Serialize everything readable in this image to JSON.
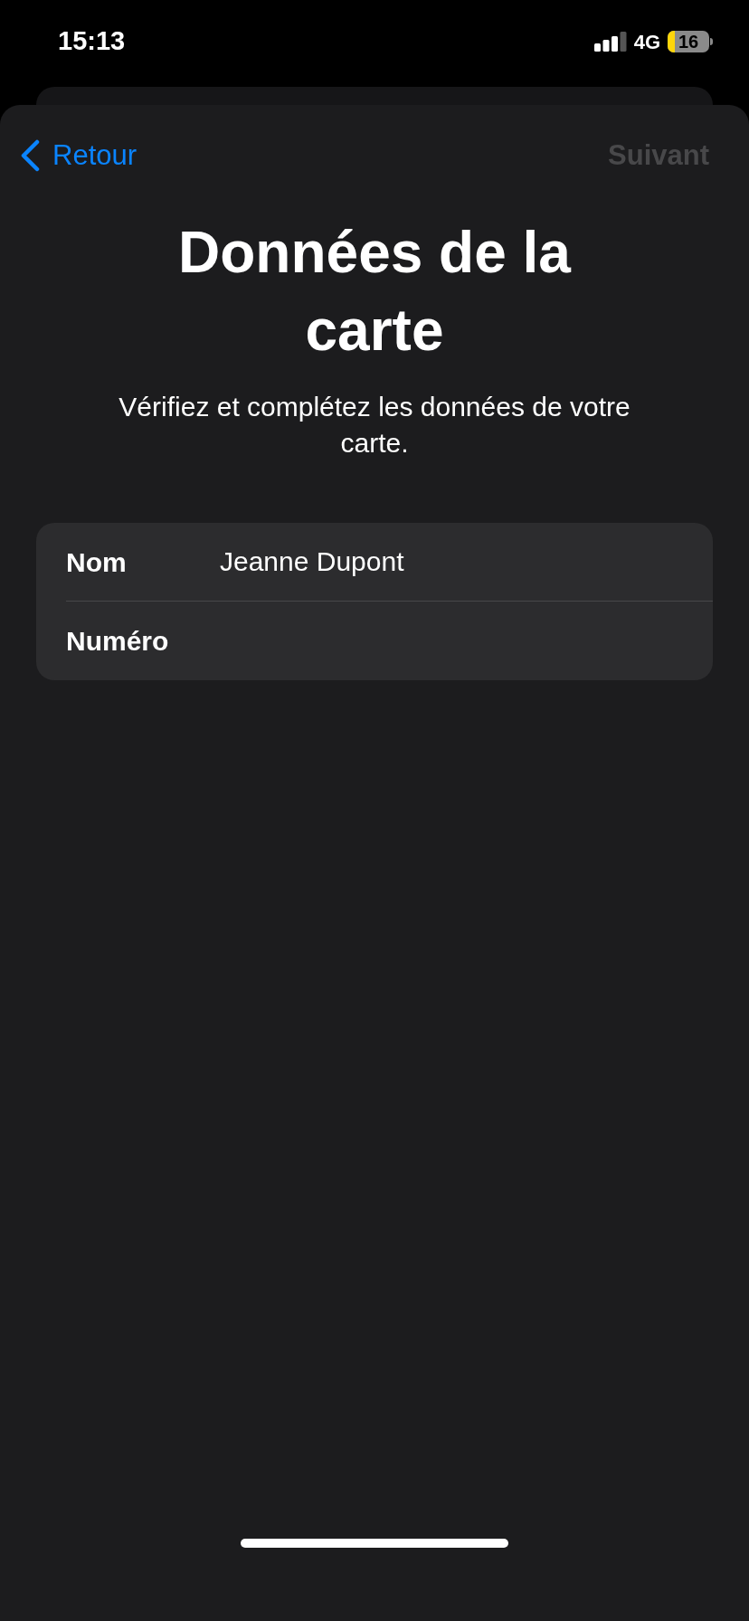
{
  "status_bar": {
    "time": "15:13",
    "network": "4G",
    "battery": "16"
  },
  "nav": {
    "back": "Retour",
    "next": {
      "label": "Suivant",
      "disabled": true
    }
  },
  "title": "Données de la carte",
  "subtitle": "Vérifiez et complétez les données de votre carte.",
  "fields": [
    {
      "label": "Nom",
      "value": "Jeanne Dupont"
    },
    {
      "label": "Numéro"
    }
  ]
}
